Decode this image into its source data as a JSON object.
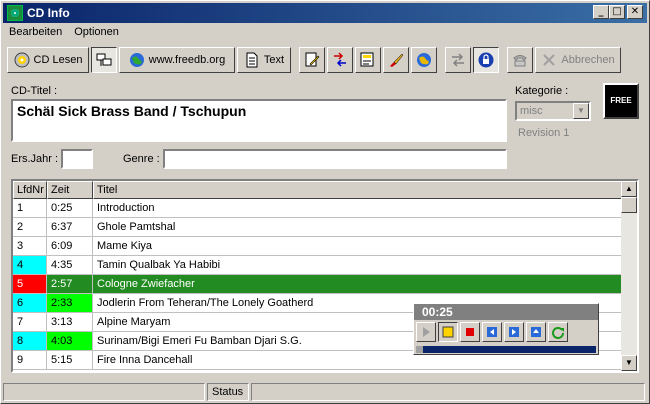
{
  "window": {
    "title": "CD Info"
  },
  "titlebar_buttons": {
    "minimize": "_",
    "maximize": "□",
    "close": "✕"
  },
  "menu": [
    {
      "label": "Bearbeiten"
    },
    {
      "label": "Optionen"
    }
  ],
  "toolbar": {
    "cd_lesen": "CD Lesen",
    "freedb": "www.freedb.org",
    "text": "Text",
    "abbrechen": "Abbrechen"
  },
  "form": {
    "cd_titel_label": "CD-Titel :",
    "cd_titel_value": "Schäl Sick Brass Band / Tschupun",
    "kategorie_label": "Kategorie :",
    "kategorie_value": "misc",
    "revision": "Revision 1",
    "ersjahr_label": "Ers.Jahr :",
    "ersjahr_value": "",
    "genre_label": "Genre :",
    "genre_value": ""
  },
  "logo": {
    "text": "FREE"
  },
  "table": {
    "columns": [
      "LfdNr",
      "Zeit",
      "Titel"
    ],
    "rows": [
      {
        "nr": "1",
        "zeit": "0:25",
        "titel": "Introduction",
        "nr_bg": "",
        "zeit_bg": "",
        "row_bg": ""
      },
      {
        "nr": "2",
        "zeit": "6:37",
        "titel": "Ghole Pamtshal",
        "nr_bg": "",
        "zeit_bg": "",
        "row_bg": ""
      },
      {
        "nr": "3",
        "zeit": "6:09",
        "titel": "Mame Kiya",
        "nr_bg": "",
        "zeit_bg": "",
        "row_bg": ""
      },
      {
        "nr": "4",
        "zeit": "4:35",
        "titel": "Tamin Qualbak Ya Habibi",
        "nr_bg": "#00ffff",
        "zeit_bg": "",
        "row_bg": ""
      },
      {
        "nr": "5",
        "zeit": "2:57",
        "titel": "Cologne Zwiefacher",
        "nr_bg": "#ff0000",
        "zeit_bg": "",
        "row_bg": "#228b22"
      },
      {
        "nr": "6",
        "zeit": "2:33",
        "titel": "Jodlerin From Teheran/The Lonely Goatherd",
        "nr_bg": "#00ffff",
        "zeit_bg": "#00ff00",
        "row_bg": ""
      },
      {
        "nr": "7",
        "zeit": "3:13",
        "titel": "Alpine Maryam",
        "nr_bg": "",
        "zeit_bg": "",
        "row_bg": ""
      },
      {
        "nr": "8",
        "zeit": "4:03",
        "titel": "Surinam/Bigi Emeri Fu Bamban Djari S.G.",
        "nr_bg": "#00ffff",
        "zeit_bg": "#00ff00",
        "row_bg": ""
      },
      {
        "nr": "9",
        "zeit": "5:15",
        "titel": "Fire Inna Dancehall",
        "nr_bg": "",
        "zeit_bg": "",
        "row_bg": ""
      }
    ]
  },
  "player": {
    "time": "00:25",
    "progress": 0.04
  },
  "status": {
    "text": "Status"
  }
}
